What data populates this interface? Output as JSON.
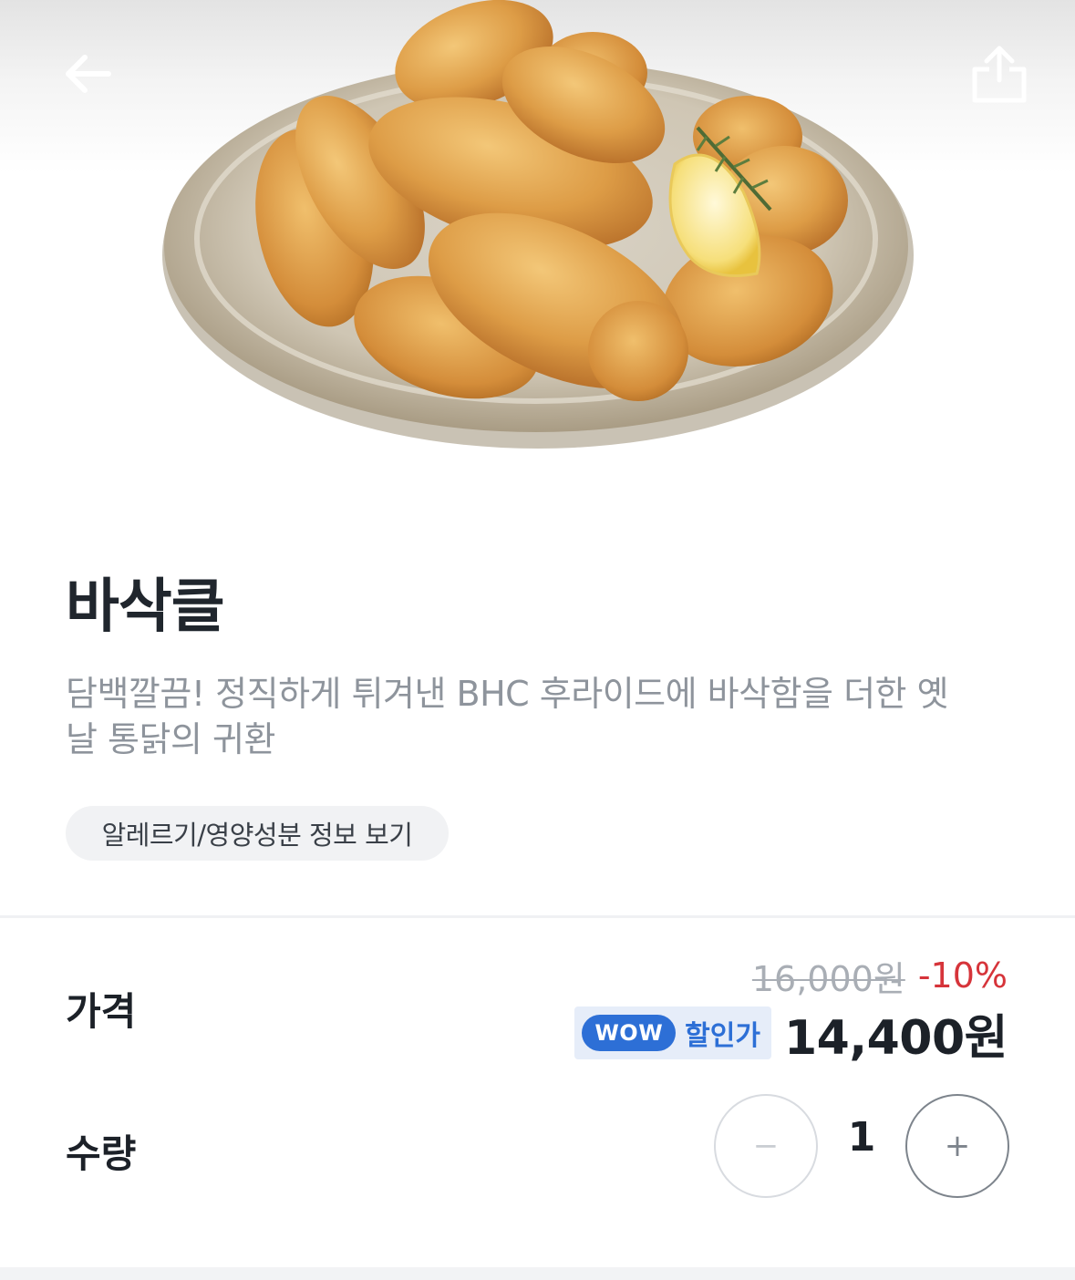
{
  "header": {
    "back_icon": "arrow-left-icon",
    "share_icon": "share-icon"
  },
  "product": {
    "image_alt": "fried-chicken-plate",
    "name": "바삭클",
    "description": "담백깔끔! 정직하게 튀겨낸 BHC 후라이드에 바삭함을 더한 옛날 통닭의 귀환",
    "allergy_button": "알레르기/영양성분 정보 보기"
  },
  "price": {
    "label": "가격",
    "original": "16,000원",
    "discount": "-10%",
    "wow_badge": "WOW",
    "wow_label": "할인가",
    "sale": "14,400원"
  },
  "quantity": {
    "label": "수량",
    "minus": "−",
    "value": "1",
    "plus": "+"
  },
  "colors": {
    "accent_blue": "#2d6fd6",
    "discount_red": "#d6343a",
    "text_dark": "#1c2128",
    "text_muted": "#8e949c"
  }
}
